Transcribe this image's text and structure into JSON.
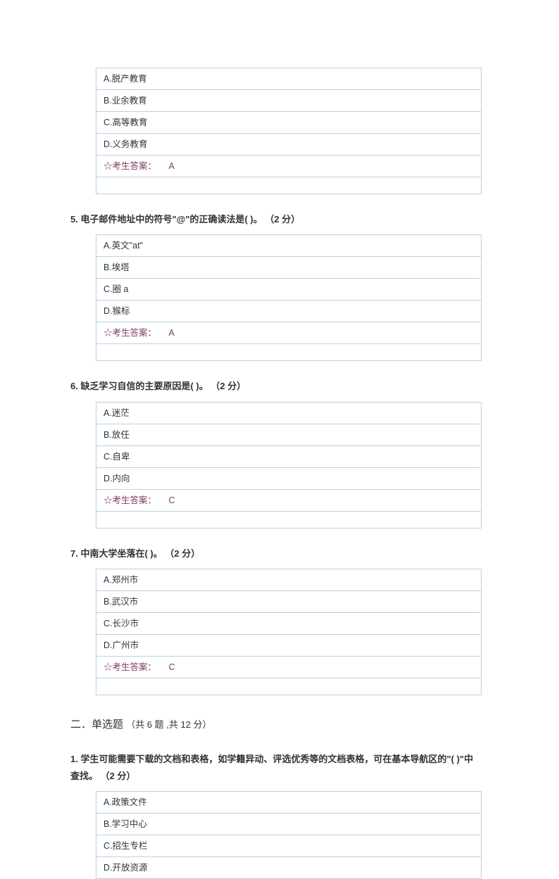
{
  "q4": {
    "options": {
      "A": "A.脱产教育",
      "B": "B.业余教育",
      "C": "C.高等教育",
      "D": "D.义务教育"
    },
    "answer_label": "☆考生答案：",
    "answer_value": "A"
  },
  "q5": {
    "number": "5.",
    "text": "电子邮件地址中的符号\"@\"的正确读法是( )。",
    "points": "（2 分）",
    "options": {
      "A": "A.英文\"at\"",
      "B": "B.埃塔",
      "C": "C.圈 a",
      "D": "D.猴标"
    },
    "answer_label": "☆考生答案：",
    "answer_value": "A"
  },
  "q6": {
    "number": "6.",
    "text": "缺乏学习自信的主要原因是( )。",
    "points": "（2 分）",
    "options": {
      "A": "A.迷茫",
      "B": "B.放任",
      "C": "C.自卑",
      "D": "D.内向"
    },
    "answer_label": "☆考生答案：",
    "answer_value": "C"
  },
  "q7": {
    "number": "7.",
    "text": "中南大学坐落在( )。",
    "points": "（2 分）",
    "options": {
      "A": "A.郑州市",
      "B": "B.武汉市",
      "C": "C.长沙市",
      "D": "D.广州市"
    },
    "answer_label": "☆考生答案：",
    "answer_value": "C"
  },
  "section2": {
    "title": "二．单选题",
    "subtitle": "（共 6 题 ,共 12 分）"
  },
  "s2q1": {
    "number": "1.",
    "text": "学生可能需要下载的文档和表格，如学籍异动、评选优秀等的文档表格，可在基本导航区的\"( )\"中查找。",
    "points": "（2 分）",
    "options": {
      "A": "A.政策文件",
      "B": "B.学习中心",
      "C": "C.招生专栏",
      "D": "D.开放资源"
    }
  }
}
